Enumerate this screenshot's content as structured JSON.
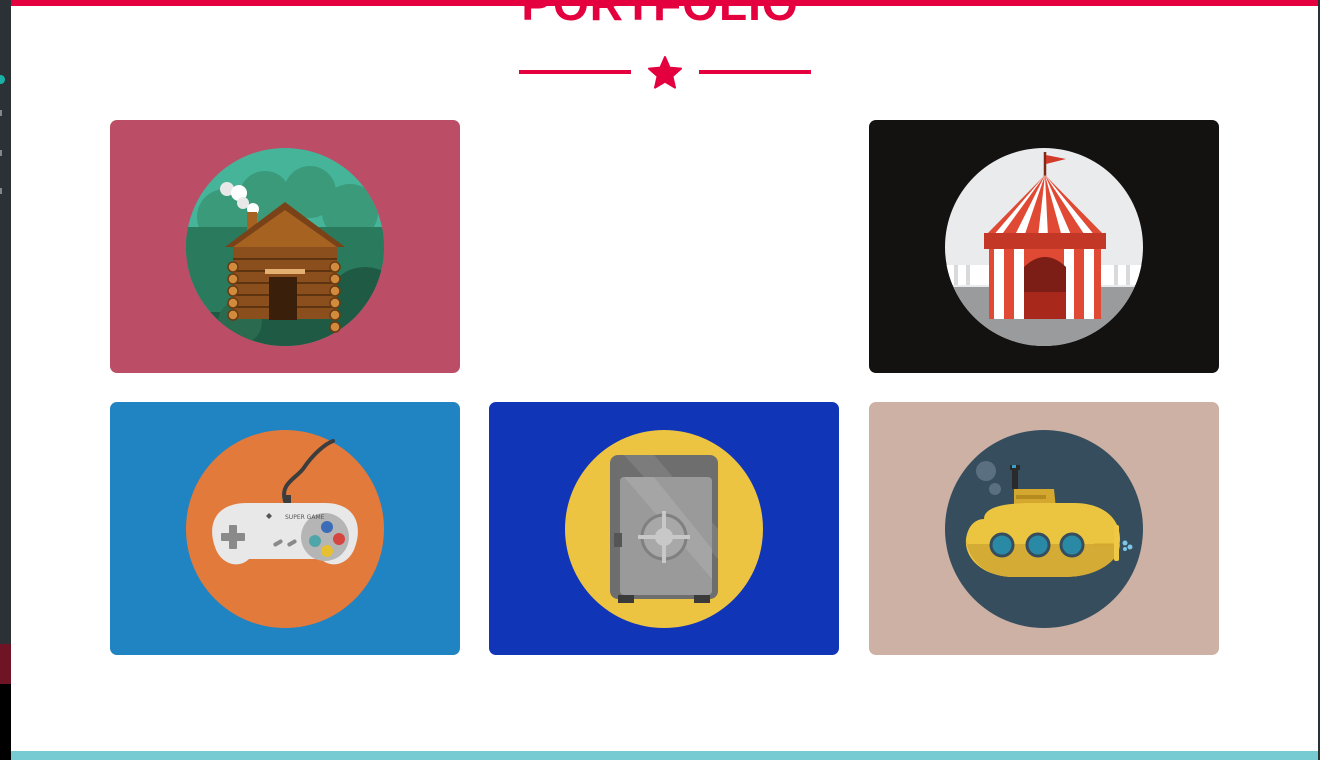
{
  "section": {
    "title": "PORTFOLIO"
  },
  "colors": {
    "accent": "#e4003f",
    "footer_band": "#76cbd2"
  },
  "divider": {
    "icon": "star-icon"
  },
  "portfolio_items": [
    {
      "icon": "log-cabin-icon",
      "background": "#bb4e66"
    },
    {
      "icon": "circus-tent-icon",
      "background": "#141111"
    },
    {
      "icon": "game-controller-icon",
      "background": "#2083c2"
    },
    {
      "icon": "safe-icon",
      "background": "#1135b7"
    },
    {
      "icon": "submarine-icon",
      "background": "#cdb1a4"
    }
  ],
  "controller_brand": "SUPER GAME"
}
